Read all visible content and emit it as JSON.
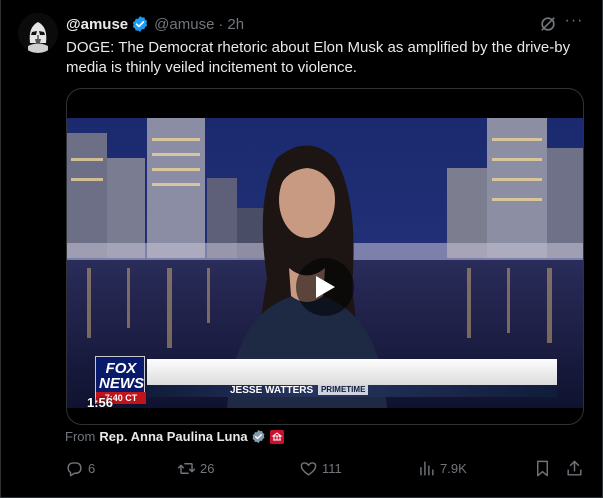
{
  "post": {
    "display_name": "@amuse",
    "handle": "@amuse",
    "separator": "·",
    "time": "2h",
    "text": "DOGE: The Democrat rhetoric about Elon Musk as amplified by the drive-by media is thinly veiled incitement to violence.",
    "more_label": "···"
  },
  "video": {
    "duration": "1:56",
    "fox_logo": "FOX NEWS",
    "fox_time": "7:40 CT",
    "show_name": "JESSE WATTERS",
    "show_tag": "PRIMETIME"
  },
  "attribution": {
    "prefix": "From",
    "name": "Rep. Anna Paulina Luna"
  },
  "actions": {
    "replies": "6",
    "reposts": "26",
    "likes": "111",
    "views": "7.9K"
  },
  "colors": {
    "background": "#000000",
    "text_primary": "#e7e9ea",
    "text_secondary": "#71767b",
    "verified_blue": "#1d9bf0",
    "border": "#2f3336"
  },
  "icons": {
    "verified": "verified-badge-icon",
    "grok": "grok-icon",
    "more": "more-icon",
    "play": "play-icon",
    "reply": "reply-icon",
    "repost": "repost-icon",
    "like": "like-icon",
    "views": "views-icon",
    "bookmark": "bookmark-icon",
    "share": "share-icon"
  }
}
